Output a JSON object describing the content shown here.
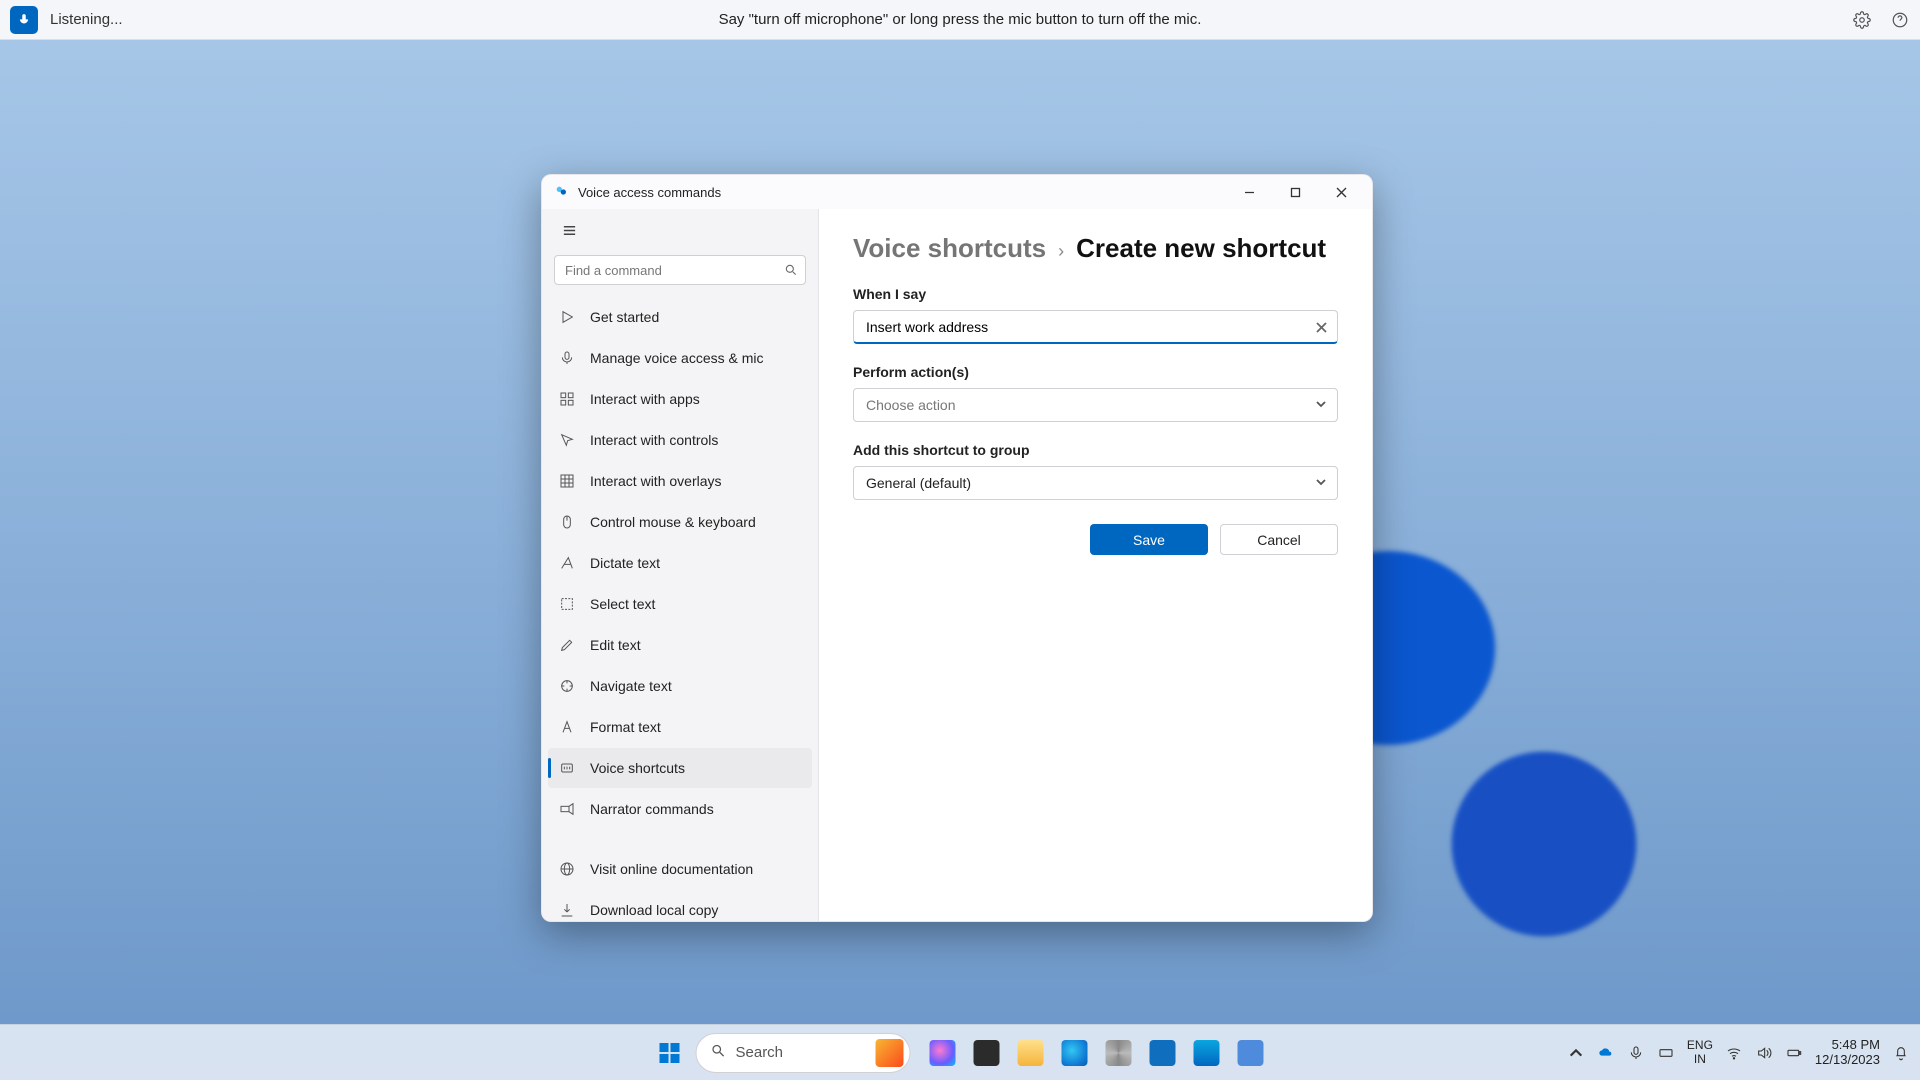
{
  "voicebar": {
    "status": "Listening...",
    "hint": "Say \"turn off microphone\" or long press the mic button to turn off the mic."
  },
  "window": {
    "title": "Voice access commands",
    "search_placeholder": "Find a command",
    "nav": {
      "get_started": "Get started",
      "manage": "Manage voice access & mic",
      "interact_apps": "Interact with apps",
      "interact_controls": "Interact with controls",
      "interact_overlays": "Interact with overlays",
      "mouse_keyboard": "Control mouse & keyboard",
      "dictate": "Dictate text",
      "select": "Select text",
      "edit": "Edit text",
      "navigate": "Navigate text",
      "format": "Format text",
      "shortcuts": "Voice shortcuts",
      "narrator": "Narrator commands",
      "docs": "Visit online documentation",
      "download": "Download local copy"
    },
    "breadcrumb": {
      "root": "Voice shortcuts",
      "leaf": "Create new shortcut"
    },
    "form": {
      "when_label": "When I say",
      "when_value": "Insert work address",
      "action_label": "Perform action(s)",
      "action_placeholder": "Choose action",
      "group_label": "Add this shortcut to group",
      "group_value": "General (default)",
      "save": "Save",
      "cancel": "Cancel"
    }
  },
  "taskbar": {
    "search": "Search",
    "lang_top": "ENG",
    "lang_bottom": "IN",
    "time": "5:48 PM",
    "date": "12/13/2023"
  }
}
